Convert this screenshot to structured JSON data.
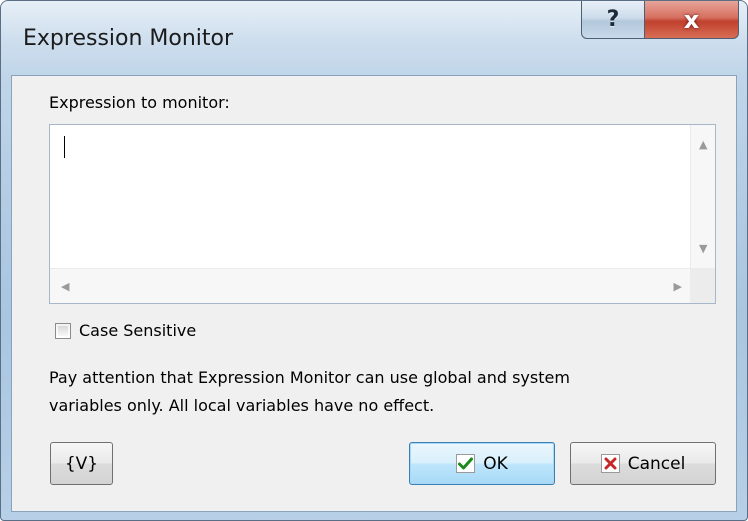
{
  "window": {
    "title": "Expression Monitor",
    "help_glyph": "?",
    "close_glyph": "x"
  },
  "form": {
    "expression_label": "Expression to monitor:",
    "expression_value": "",
    "case_sensitive_label": "Case Sensitive",
    "case_sensitive_checked": false,
    "note_line1": "Pay attention that Expression Monitor can use global and system",
    "note_line2": "variables only. All local variables have no effect."
  },
  "buttons": {
    "variables_label": "{V}",
    "ok_label": "OK",
    "cancel_label": "Cancel"
  },
  "colors": {
    "ok_check": "#1a8a1a",
    "cancel_x": "#c62828",
    "close_red": "#c0412e"
  }
}
